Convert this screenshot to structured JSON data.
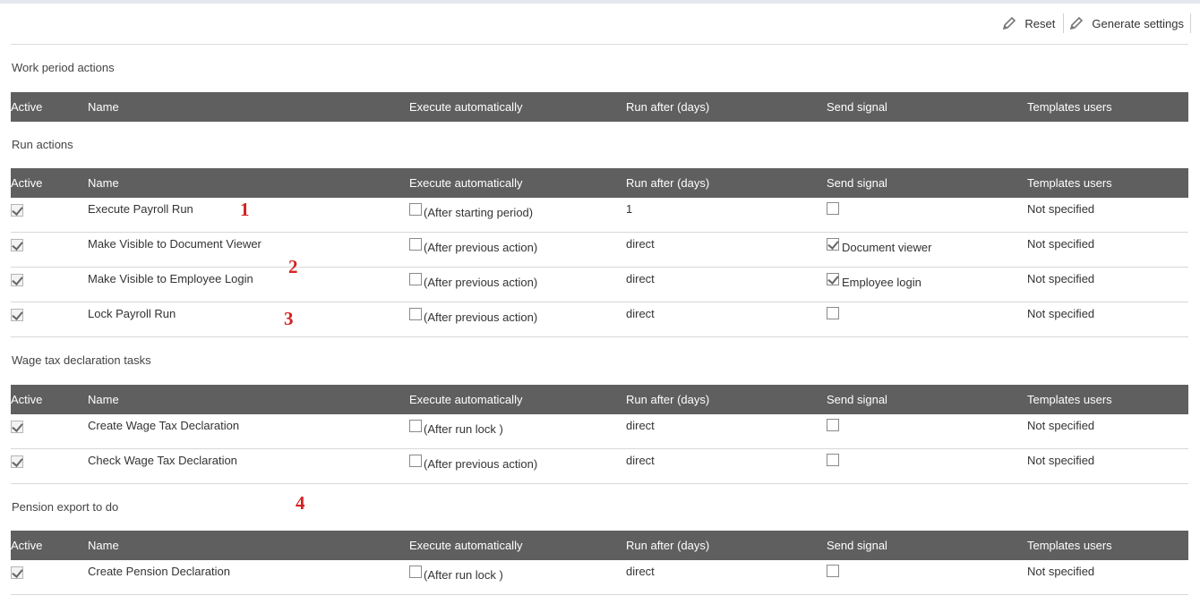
{
  "toolbar": {
    "reset_label": "Reset",
    "generate_label": "Generate settings",
    "icon": "pencil-icon"
  },
  "columns": [
    "Active",
    "Name",
    "Execute automatically",
    "Run after (days)",
    "Send signal",
    "Templates users"
  ],
  "sections": [
    {
      "title": "Work period actions",
      "rows": []
    },
    {
      "title": "Run actions",
      "rows": [
        {
          "active": true,
          "name": "Execute Payroll Run",
          "auto_checked": false,
          "auto_label": "(After starting period)",
          "run_after": "1",
          "signal_checked": false,
          "signal_label": "",
          "templates": "Not specified"
        },
        {
          "active": true,
          "name": "Make Visible to Document Viewer",
          "auto_checked": false,
          "auto_label": "(After previous action)",
          "run_after": "direct",
          "signal_checked": true,
          "signal_label": "Document viewer",
          "templates": "Not specified"
        },
        {
          "active": true,
          "name": "Make Visible to Employee Login",
          "auto_checked": false,
          "auto_label": "(After previous action)",
          "run_after": "direct",
          "signal_checked": true,
          "signal_label": "Employee login",
          "templates": "Not specified"
        },
        {
          "active": true,
          "name": "Lock Payroll Run",
          "auto_checked": false,
          "auto_label": "(After previous action)",
          "run_after": "direct",
          "signal_checked": false,
          "signal_label": "",
          "templates": "Not specified"
        }
      ]
    },
    {
      "title": "Wage tax declaration tasks",
      "rows": [
        {
          "active": true,
          "name": "Create Wage Tax Declaration",
          "auto_checked": false,
          "auto_label": "(After run lock )",
          "run_after": "direct",
          "signal_checked": false,
          "signal_label": "",
          "templates": "Not specified"
        },
        {
          "active": true,
          "name": "Check Wage Tax Declaration",
          "auto_checked": false,
          "auto_label": "(After previous action)",
          "run_after": "direct",
          "signal_checked": false,
          "signal_label": "",
          "templates": "Not specified"
        }
      ]
    },
    {
      "title": "Pension export to do",
      "rows": [
        {
          "active": true,
          "name": "Create Pension Declaration",
          "auto_checked": false,
          "auto_label": "(After run lock )",
          "run_after": "direct",
          "signal_checked": false,
          "signal_label": "",
          "templates": "Not specified"
        }
      ]
    }
  ],
  "markers": [
    "1",
    "2",
    "3",
    "4"
  ],
  "colors": {
    "header_bg": "#5f5f5f",
    "marker": "#d42222"
  }
}
